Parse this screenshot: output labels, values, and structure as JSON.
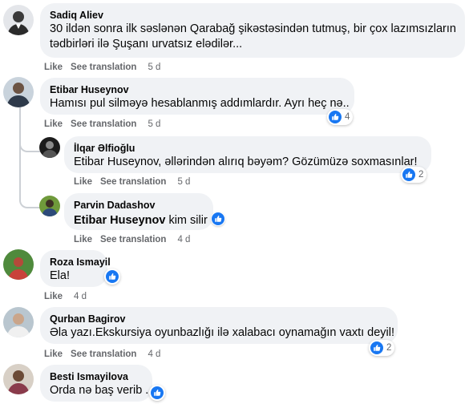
{
  "comments": [
    {
      "author": "Sadiq Aliev",
      "lines": [
        "30 ildən sonra ilk səslənən Qarabağ şikəstəsindən tutmuş, bir çox lazımsızların",
        "tədbirləri ilə Şuşanı urvatsız elədilər..."
      ],
      "actions": {
        "like": "Like",
        "translate": "See translation",
        "time": "5 d"
      }
    },
    {
      "author": "Etibar Huseynov",
      "lines": [
        "Hamısı pul silməyə hesablanmış addımlardır. Ayrı heç nə.."
      ],
      "reaction_count": "4",
      "actions": {
        "like": "Like",
        "translate": "See translation",
        "time": "5 d"
      }
    },
    {
      "author": "İlqar Əlfioğlu",
      "lines": [
        "Etibar Huseynov, əllərindən alırıq bəyəm? Gözümüzə soxmasınlar!"
      ],
      "reaction_count": "2",
      "actions": {
        "like": "Like",
        "translate": "See translation",
        "time": "5 d"
      }
    },
    {
      "author": "Parvin Dadashov",
      "tag": "Etibar Huseynov",
      "text": "kim silir",
      "actions": {
        "like": "Like",
        "translate": "See translation",
        "time": "4 d"
      }
    },
    {
      "author": "Roza Ismayil",
      "lines": [
        "Ela!"
      ],
      "actions": {
        "like": "Like",
        "time": "4 d"
      }
    },
    {
      "author": "Qurban Bagirov",
      "lines": [
        "Əla yazı.Ekskursiya oyunbazlığı ilə xalabacı oynamağın vaxtı deyil!"
      ],
      "reaction_count": "2",
      "actions": {
        "like": "Like",
        "translate": "See translation",
        "time": "4 d"
      }
    },
    {
      "author": "Besti Ismayilova",
      "lines": [
        "Orda nə baş verib .."
      ]
    }
  ],
  "colors": {
    "bubble": "#f0f2f5",
    "like_blue": "#1877f2",
    "meta_gray": "#65676b"
  },
  "icons": {
    "reaction": "thumbs-up-icon"
  }
}
